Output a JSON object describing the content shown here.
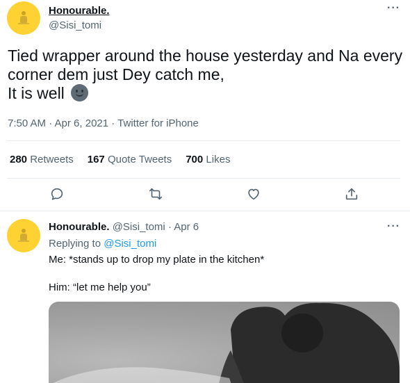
{
  "main_tweet": {
    "name": "Honourable.",
    "handle": "@Sisi_tomi",
    "text_line1": "Tied wrapper around the house yesterday and Na every",
    "text_line2": "corner dem just Dey catch me,",
    "text_line3": "It is well",
    "emoji": "slightly-smiling-face",
    "meta": "7:50 AM · Apr 6, 2021 · Twitter for iPhone",
    "stats": {
      "retweets_count": "280",
      "retweets_label": "Retweets",
      "quotes_count": "167",
      "quotes_label": "Quote Tweets",
      "likes_count": "700",
      "likes_label": "Likes"
    }
  },
  "actions": {
    "icons": [
      "reply-icon",
      "retweet-icon",
      "like-icon",
      "share-icon"
    ]
  },
  "reply_tweet": {
    "name": "Honourable.",
    "handle": "@Sisi_tomi",
    "separator": "·",
    "date": "Apr 6",
    "replying_prefix": "Replying to",
    "replying_to": "@Sisi_tomi",
    "line1": "Me: *stands up to drop my plate in the kitchen*",
    "line2": "Him: “let me help you”"
  },
  "colors": {
    "accent": "#1d9bf0",
    "secondary_text": "#536471",
    "avatar": "#ffd233"
  }
}
